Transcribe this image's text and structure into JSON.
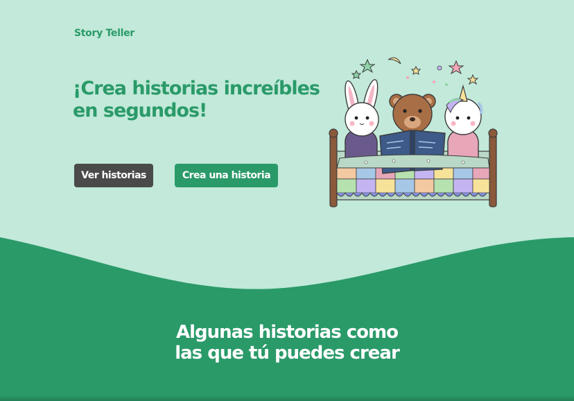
{
  "brand": {
    "name": "Story Teller"
  },
  "hero": {
    "headline": "¡Crea historias increíbles en segundos!",
    "buttons": {
      "view_label": "Ver historias",
      "create_label": "Crea una historia"
    },
    "illustration_icon": "storybook-illustration-icon"
  },
  "stories_section": {
    "title_line1": "Algunas historias como",
    "title_line2": "las que tú puedes crear"
  },
  "colors": {
    "background": "#c2e9d9",
    "accent": "#2a9a69",
    "dark_button": "#4a4a4a",
    "text_light": "#ffffff"
  }
}
